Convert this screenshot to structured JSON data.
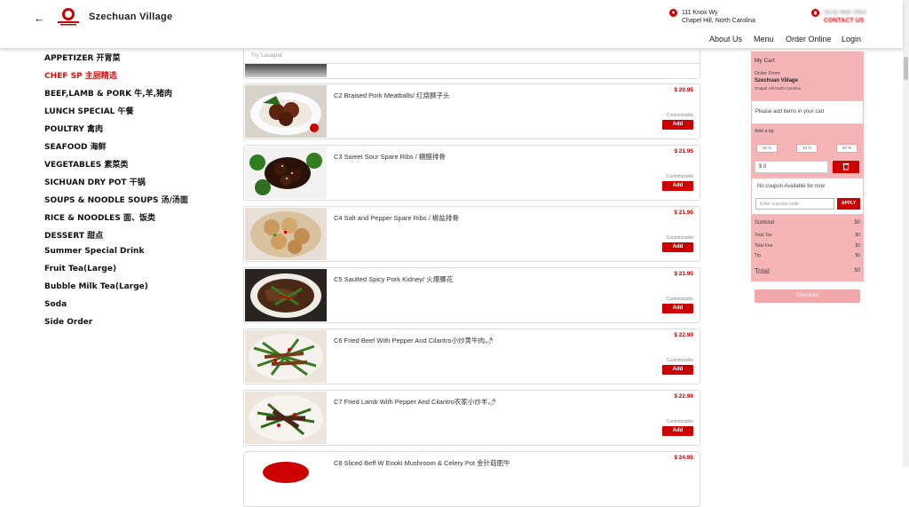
{
  "header": {
    "brand": "Szechuan Village",
    "address_line1": "111 Knox Wy",
    "address_line2": "Chapel Hill, North Carolina",
    "phone_blurred": "(919) 968-7854",
    "phone_label": "CONTACT US",
    "nav": [
      "About Us",
      "Menu",
      "Order Online",
      "Login"
    ]
  },
  "categories": [
    {
      "label": "APPETIZER 开胃菜",
      "active": false
    },
    {
      "label": "CHEF SP 主厨精选",
      "active": true
    },
    {
      "label": "BEEF,LAMB & PORK 牛,羊,猪肉",
      "active": false
    },
    {
      "label": "LUNCH SPECIAL 午餐",
      "active": false
    },
    {
      "label": "POULTRY 禽肉",
      "active": false
    },
    {
      "label": "SEAFOOD 海鲜",
      "active": false
    },
    {
      "label": "VEGETABLES 素菜类",
      "active": false
    },
    {
      "label": "SICHUAN DRY POT 干锅",
      "active": false
    },
    {
      "label": "SOUPS & NOODLE SOUPS 汤/汤面",
      "active": false
    },
    {
      "label": "RICE & NOODLES 面、饭类",
      "active": false
    },
    {
      "label": "DESSERT 甜点",
      "active": false
    },
    {
      "label": "Summer Special Drink",
      "active": false
    },
    {
      "label": "Fruit Tea(Large)",
      "active": false
    },
    {
      "label": "Bubble Milk Tea(Large)",
      "active": false
    },
    {
      "label": "Soda",
      "active": false
    },
    {
      "label": "Side Order",
      "active": false
    }
  ],
  "search": {
    "placeholder": "Try 'Lasagna'"
  },
  "items": [
    {
      "name": "C2 Braised Pork Meatballs/ 红烧狮子头",
      "price": "$ 20.95",
      "customizable": "Customizable",
      "add": "Add",
      "image": "plate"
    },
    {
      "name": "C3 Sweet Sour Spare Ribs / 糖醋排骨",
      "price": "$ 21.95",
      "customizable": "Customizable",
      "add": "Add",
      "image": "ribs"
    },
    {
      "name": "C4 Salt and Pepper Spare Ribs / 椒盐排骨",
      "price": "$ 21.95",
      "customizable": "Customizable",
      "add": "Add",
      "image": "fried"
    },
    {
      "name": "C5 Saulted Spicy Pork Kidney/ 火爆腰花",
      "price": "$ 21.95",
      "customizable": "Customizable",
      "add": "Add",
      "image": "kidney"
    },
    {
      "name": "C6 Fried Beef With Pepper And Cilantro小炒黄牛肉🌶",
      "price": "$ 22.99",
      "customizable": "Customizable",
      "add": "Add",
      "image": "beef"
    },
    {
      "name": "C7 Fried Lamb With Pepper And Cilantro农家小炒羊🌶",
      "price": "$ 22.99",
      "customizable": "Customizable",
      "add": "Add",
      "image": "lamb"
    },
    {
      "name": "C8 Sliced Beff W Enoki Mushroom & Celery Pot 金针菇肥牛",
      "price": "$ 24.95",
      "customizable": "",
      "add": "",
      "image": "pot"
    }
  ],
  "cart": {
    "title": "My Cart",
    "order_from": "Order From",
    "restaurant": "Szechuan Village",
    "city": "Chapel Hill North Carolina",
    "empty_msg": "Please add items in your cart",
    "tip_label": "Add a tip",
    "tip_options": [
      "10 %",
      "15 %",
      "20 %"
    ],
    "tip_value": "$ 0",
    "no_coupon": "No coupon Available for now",
    "promo_placeholder": "Enter a promo code",
    "apply": "APPLY",
    "totals": [
      {
        "label": "Subtotal",
        "value": "$0"
      },
      {
        "label": "Total Tax",
        "value": "$0"
      },
      {
        "label": "Total Fee",
        "value": "$0"
      },
      {
        "label": "Tip",
        "value": "$0"
      },
      {
        "label": "Total",
        "value": "$0"
      }
    ],
    "checkout": "Checkout"
  },
  "colors": {
    "accent": "#cc0000",
    "cart_bg": "#f5b5b7"
  }
}
